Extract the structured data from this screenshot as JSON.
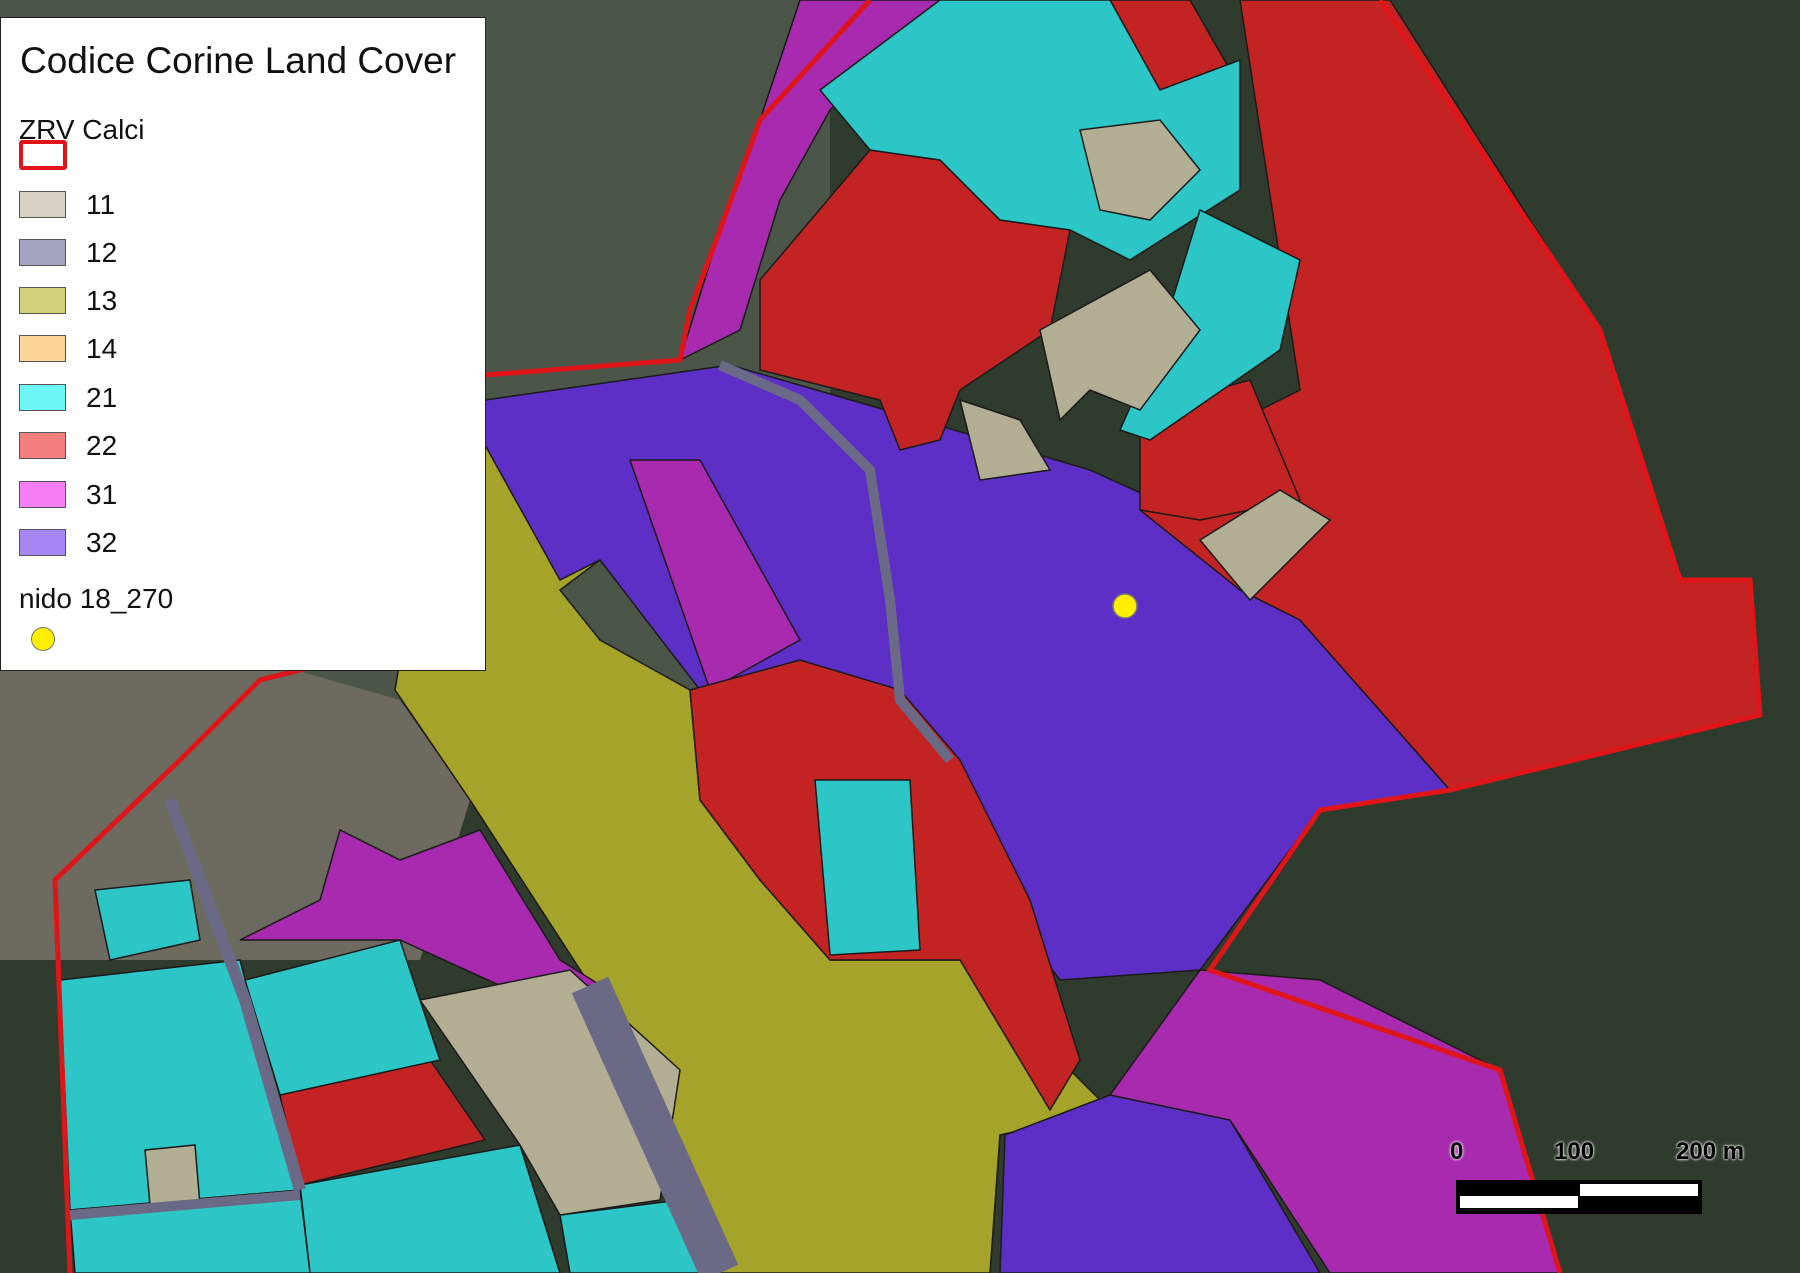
{
  "legend": {
    "title": "Codice Corine Land Cover",
    "boundary_group": "ZRV Calci",
    "boundary_color": "#e0151a",
    "classes": [
      {
        "code": "11",
        "color": "#d6d3c4"
      },
      {
        "code": "12",
        "color": "#a4a2bf"
      },
      {
        "code": "13",
        "color": "#d2d07a"
      },
      {
        "code": "14",
        "color": "#fdd596"
      },
      {
        "code": "21",
        "color": "#6cf6f6"
      },
      {
        "code": "22",
        "color": "#f37f7f"
      },
      {
        "code": "31",
        "color": "#f57ef5"
      },
      {
        "code": "32",
        "color": "#a785f2"
      }
    ],
    "nest_group": "nido 18_270",
    "nest_color": "#ffee00"
  },
  "scalebar": {
    "labels": [
      "0",
      "100",
      "200 m"
    ]
  },
  "map": {
    "fill_colors": {
      "11": "#b2ae94",
      "12": "#6b6a86",
      "13": "#a5a32a",
      "21": "#2cc6c6",
      "22": "#c42323",
      "31": "#a82aae",
      "32": "#5d2fc7"
    }
  }
}
